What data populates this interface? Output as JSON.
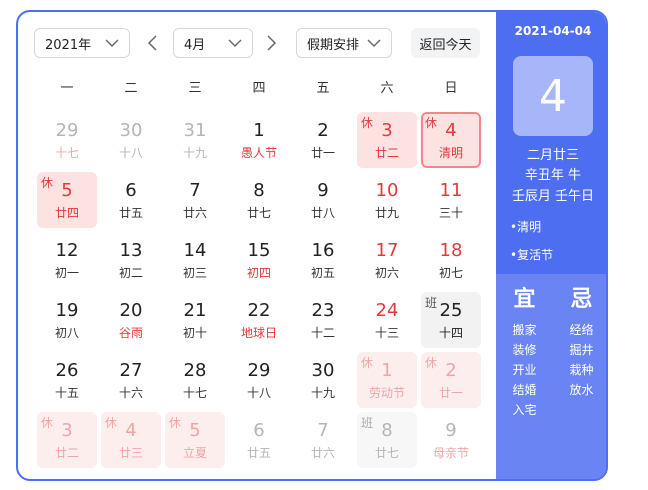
{
  "toolbar": {
    "year": "2021年",
    "month": "4月",
    "holiday": "假期安排",
    "today_label": "返回今天"
  },
  "weekdays": [
    "一",
    "二",
    "三",
    "四",
    "五",
    "六",
    "日"
  ],
  "weeks": [
    [
      {
        "day": "29",
        "lunar": "十七",
        "faded": true,
        "festival": true
      },
      {
        "day": "30",
        "lunar": "十八",
        "faded": true
      },
      {
        "day": "31",
        "lunar": "十九",
        "faded": true
      },
      {
        "day": "1",
        "lunar": "愚人节",
        "festival": true
      },
      {
        "day": "2",
        "lunar": "廿一"
      },
      {
        "day": "3",
        "lunar": "廿二",
        "tag": "休",
        "type": "holiday"
      },
      {
        "day": "4",
        "lunar": "清明",
        "tag": "休",
        "type": "holiday",
        "today": true
      }
    ],
    [
      {
        "day": "5",
        "lunar": "廿四",
        "tag": "休",
        "type": "holiday"
      },
      {
        "day": "6",
        "lunar": "廿五"
      },
      {
        "day": "7",
        "lunar": "廿六"
      },
      {
        "day": "8",
        "lunar": "廿七"
      },
      {
        "day": "9",
        "lunar": "廿八"
      },
      {
        "day": "10",
        "lunar": "廿九",
        "weekend": true
      },
      {
        "day": "11",
        "lunar": "三十",
        "weekend": true
      }
    ],
    [
      {
        "day": "12",
        "lunar": "初一"
      },
      {
        "day": "13",
        "lunar": "初二"
      },
      {
        "day": "14",
        "lunar": "初三"
      },
      {
        "day": "15",
        "lunar": "初四",
        "festival": true
      },
      {
        "day": "16",
        "lunar": "初五"
      },
      {
        "day": "17",
        "lunar": "初六",
        "weekend": true
      },
      {
        "day": "18",
        "lunar": "初七",
        "weekend": true
      }
    ],
    [
      {
        "day": "19",
        "lunar": "初八"
      },
      {
        "day": "20",
        "lunar": "谷雨",
        "festival": true
      },
      {
        "day": "21",
        "lunar": "初十"
      },
      {
        "day": "22",
        "lunar": "地球日",
        "festival": true
      },
      {
        "day": "23",
        "lunar": "十二"
      },
      {
        "day": "24",
        "lunar": "十三",
        "weekend": true
      },
      {
        "day": "25",
        "lunar": "十四",
        "tag": "班",
        "type": "work"
      }
    ],
    [
      {
        "day": "26",
        "lunar": "十五"
      },
      {
        "day": "27",
        "lunar": "十六"
      },
      {
        "day": "28",
        "lunar": "十七"
      },
      {
        "day": "29",
        "lunar": "十八"
      },
      {
        "day": "30",
        "lunar": "十九"
      },
      {
        "day": "1",
        "lunar": "劳动节",
        "tag": "休",
        "type": "holiday",
        "faded": true
      },
      {
        "day": "2",
        "lunar": "廿一",
        "tag": "休",
        "type": "holiday",
        "faded": true
      }
    ],
    [
      {
        "day": "3",
        "lunar": "廿二",
        "tag": "休",
        "type": "holiday",
        "faded": true
      },
      {
        "day": "4",
        "lunar": "廿三",
        "tag": "休",
        "type": "holiday",
        "faded": true
      },
      {
        "day": "5",
        "lunar": "立夏",
        "tag": "休",
        "type": "holiday",
        "faded": true
      },
      {
        "day": "6",
        "lunar": "廿五",
        "faded": true
      },
      {
        "day": "7",
        "lunar": "廿六",
        "faded": true
      },
      {
        "day": "8",
        "lunar": "廿七",
        "tag": "班",
        "type": "work",
        "faded": true
      },
      {
        "day": "9",
        "lunar": "母亲节",
        "faded": true,
        "festival": true
      }
    ]
  ],
  "detail": {
    "date": "2021-04-04",
    "day": "4",
    "lunar_date": "二月廿三",
    "ganzhi_year": "辛丑年 牛",
    "ganzhi_month_day": "壬辰月 壬午日",
    "festivals": [
      "•清明",
      "•复活节"
    ],
    "yi_label": "宜",
    "ji_label": "忌",
    "yi": [
      "搬家",
      "装修",
      "开业",
      "结婚",
      "入宅"
    ],
    "ji": [
      "经络",
      "掘井",
      "栽种",
      "放水"
    ]
  },
  "colors": {
    "accent": "#4e6ef2",
    "holiday_red": "#e4393c",
    "holiday_bg": "#fde2e2"
  }
}
